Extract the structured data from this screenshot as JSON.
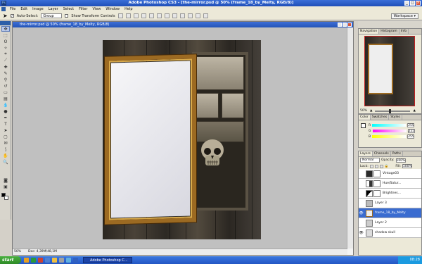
{
  "app": {
    "title": "Adobe Photoshop CS3 - [the-mirror.psd @ 50% (frame_18_by_Melty, RGB/8)]"
  },
  "menu": [
    "File",
    "Edit",
    "Image",
    "Layer",
    "Select",
    "Filter",
    "View",
    "Window",
    "Help"
  ],
  "options": {
    "auto_select_label": "Auto-Select:",
    "auto_select_value": "Group",
    "transform_label": "Show Transform Controls",
    "workspace_label": "Workspace ▾"
  },
  "document": {
    "title": "the-mirror.psd @ 50% (frame_18_by_Melty, RGB/8)",
    "zoom": "50%",
    "doc_size": "Doc: 4,39M/48,1M"
  },
  "navigator": {
    "tabs": [
      "Navigation",
      "Histogram",
      "Info"
    ],
    "zoom": "50%"
  },
  "color": {
    "tabs": [
      "Color",
      "Swatches",
      "Styles"
    ],
    "channels": [
      {
        "label": "R",
        "value": "255"
      },
      {
        "label": "G",
        "value": "255"
      },
      {
        "label": "B",
        "value": "255"
      }
    ]
  },
  "layers": {
    "tabs": [
      "Layers",
      "Channels",
      "Paths"
    ],
    "blend_mode": "Normal",
    "opacity_label": "Opacity:",
    "opacity_value": "100%",
    "lock_label": "Lock:",
    "fill_label": "Fill:",
    "fill_value": "100%",
    "items": [
      {
        "name": "Vintage03",
        "visible": false,
        "mask": true
      },
      {
        "name": "Hue/Satur...",
        "visible": false,
        "mask": true
      },
      {
        "name": "Brightnes...",
        "visible": false,
        "mask": true
      },
      {
        "name": "Layer 3",
        "visible": false,
        "mask": false
      },
      {
        "name": "frame_18_by_Melty",
        "visible": true,
        "mask": false,
        "selected": true
      },
      {
        "name": "Layer 2",
        "visible": false,
        "mask": false
      },
      {
        "name": "shadow skull",
        "visible": true,
        "mask": false
      }
    ]
  },
  "taskbar": {
    "start_label": "start",
    "active_task": "Adobe Photoshop C...",
    "clock": "08:28"
  },
  "colors": {
    "accent": "#3a6cd0",
    "frame_gold": "#9c6a22"
  }
}
